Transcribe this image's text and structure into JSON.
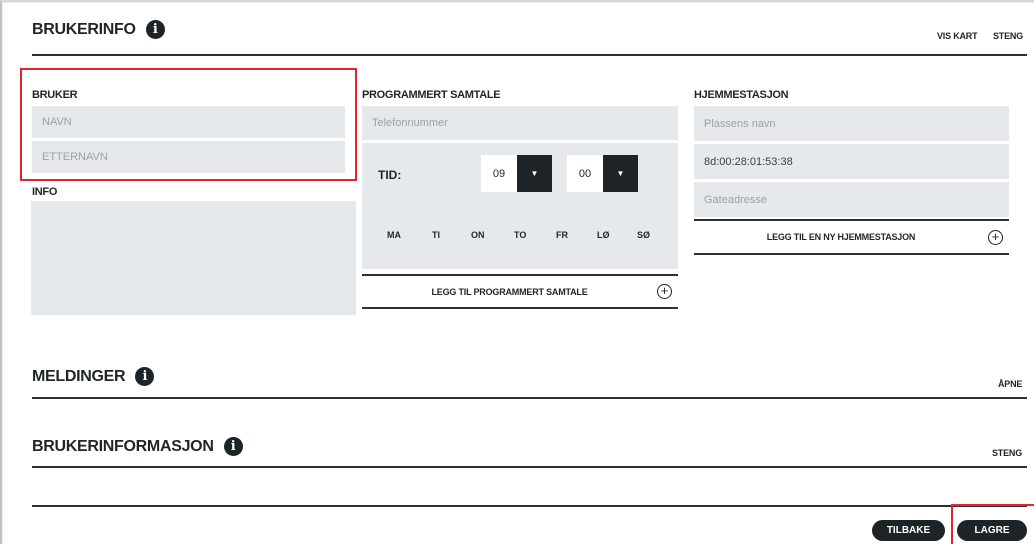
{
  "brukerinfo": {
    "title": "BRUKERINFO",
    "info_glyph": "i",
    "links": {
      "vis_kart": "VIS KART",
      "steng": "STENG"
    },
    "bruker": {
      "title": "BRUKER",
      "navn_placeholder": "NAVN",
      "etternavn_placeholder": "ETTERNAVN"
    },
    "info": {
      "title": "INFO"
    },
    "programmert": {
      "title": "PROGRAMMERT SAMTALE",
      "telefon_placeholder": "Telefonnummer",
      "tid_label": "TID:",
      "hour": "09",
      "minute": "00",
      "arrow": "▼",
      "days": [
        "MA",
        "TI",
        "ON",
        "TO",
        "FR",
        "LØ",
        "SØ"
      ],
      "add_label": "LEGG TIL PROGRAMMERT SAMTALE",
      "plus": "+"
    },
    "hjemmestasjon": {
      "title": "HJEMMESTASJON",
      "plassens_navn_placeholder": "Plassens navn",
      "mac_value": "8d:00:28:01:53:38",
      "gateadresse_placeholder": "Gateadresse",
      "add_label": "LEGG TIL EN NY HJEMMESTASJON",
      "plus": "+"
    }
  },
  "meldinger": {
    "title": "MELDINGER",
    "info_glyph": "i",
    "link": "ÅPNE"
  },
  "brukerinformasjon": {
    "title": "BRUKERINFORMASJON",
    "info_glyph": "i",
    "link": "STENG"
  },
  "footer": {
    "tilbake": "TILBAKE",
    "lagre": "LAGRE"
  },
  "colors": {
    "accent": "#1d2326",
    "field_bg": "#e6e9eb",
    "highlight": "#e4262a"
  }
}
